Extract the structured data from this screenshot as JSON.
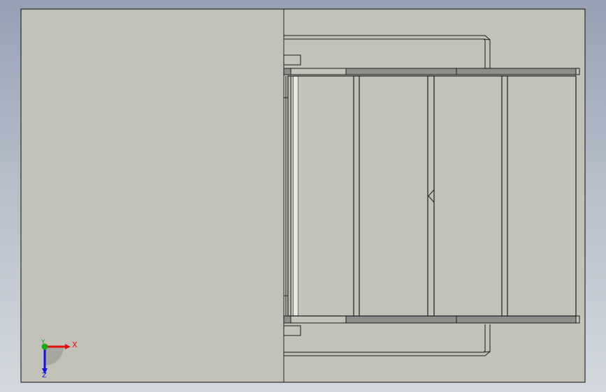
{
  "viewport": {
    "background_top": "#95a1b3",
    "background_bottom": "#d3d8de"
  },
  "sheet": {
    "fill": "#c2c2b8",
    "edge": "#2a2a2a"
  },
  "model": {
    "fill": "#c3c3b9",
    "rail_fill": "#8e8e8a",
    "line": "#1c1c1c",
    "panel_count": 4
  },
  "triad": {
    "x_label": "X",
    "y_label": "Y",
    "z_label": "Z",
    "x_color": "#e01010",
    "y_color": "#10b010",
    "z_color": "#1010e0"
  }
}
